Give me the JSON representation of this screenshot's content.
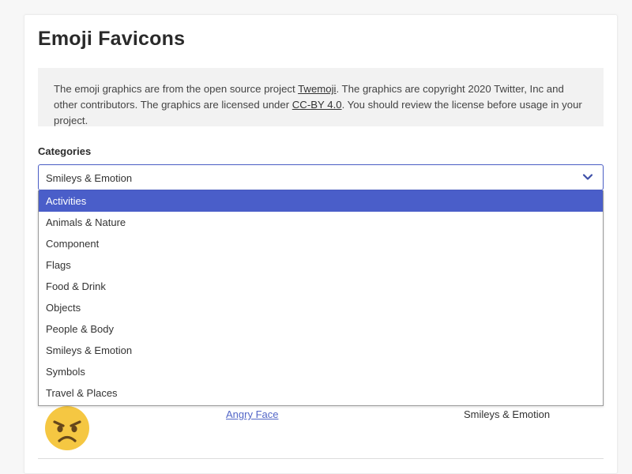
{
  "page": {
    "title": "Emoji Favicons"
  },
  "notice": {
    "text_before": "The emoji graphics are from the open source project ",
    "link1": "Twemoji",
    "text_middle": ". The graphics are copyright 2020 Twitter, Inc and other contributors. The graphics are licensed under ",
    "link2": "CC-BY 4.0",
    "text_after": ". You should review the license before usage in your project."
  },
  "categories": {
    "label": "Categories",
    "selected_value": "Smileys & Emotion",
    "highlighted_option": "Activities",
    "options": [
      "Activities",
      "Animals & Nature",
      "Component",
      "Flags",
      "Food & Drink",
      "Objects",
      "People & Body",
      "Smileys & Emotion",
      "Symbols",
      "Travel & Places"
    ]
  },
  "results": {
    "rows": [
      {
        "name": "Angry Face",
        "category": "Smileys & Emotion",
        "icon": "angry-face-emoji"
      }
    ]
  },
  "colors": {
    "accent": "#4a5ec9",
    "link": "#5366c7",
    "emoji_face": "#f5c742"
  }
}
